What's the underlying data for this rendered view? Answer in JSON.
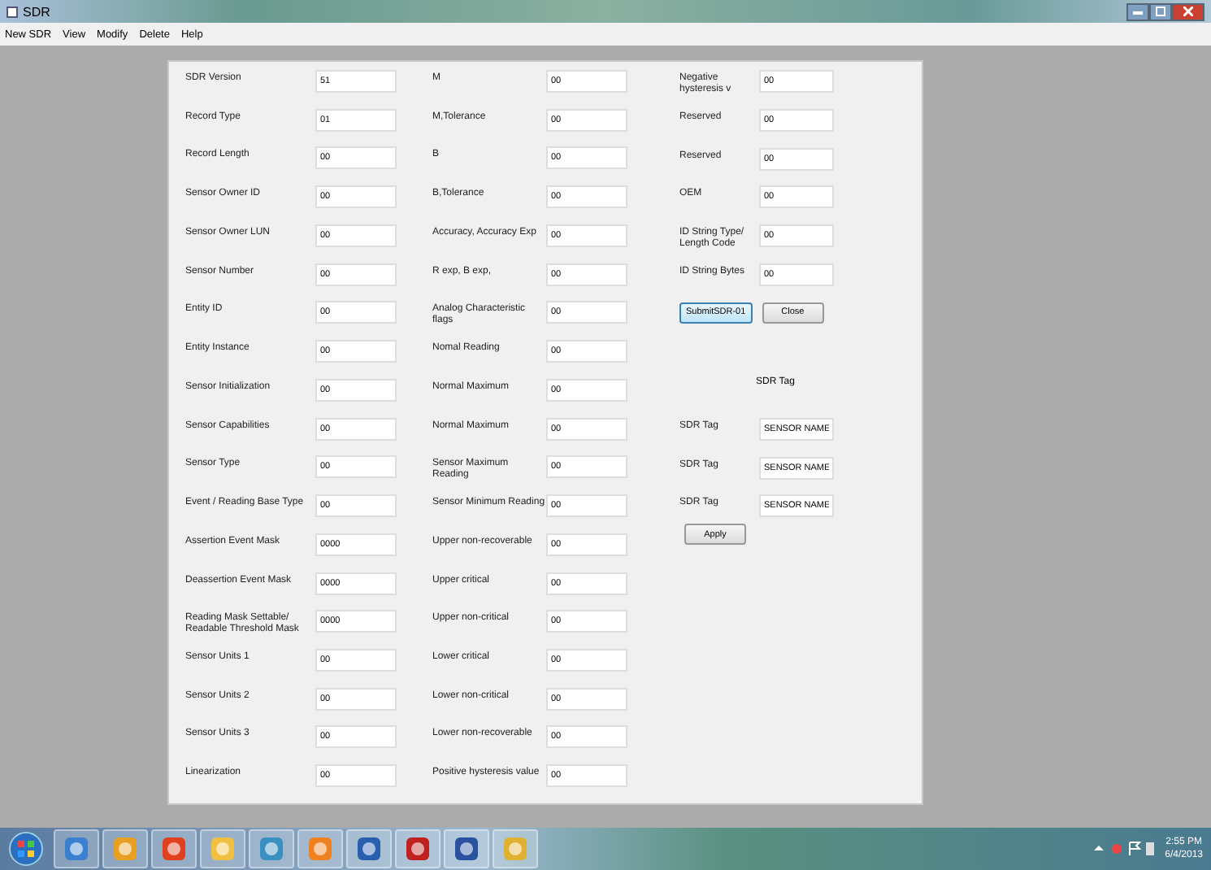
{
  "window": {
    "title": "SDR"
  },
  "menu": [
    "New SDR",
    "View",
    "Modify",
    "Delete",
    "Help"
  ],
  "columns": [
    {
      "fields": [
        {
          "label": "SDR Version",
          "value": "51"
        },
        {
          "label": "Record Type",
          "value": "01"
        },
        {
          "label": "Record Length",
          "value": "00"
        },
        {
          "label": "Sensor Owner ID",
          "value": "00"
        },
        {
          "label": "Sensor Owner LUN",
          "value": "00"
        },
        {
          "label": "Sensor Number",
          "value": "00"
        },
        {
          "label": "Entity ID",
          "value": "00"
        },
        {
          "label": "Entity Instance",
          "value": "00"
        },
        {
          "label": "Sensor Initialization",
          "value": "00"
        },
        {
          "label": "Sensor Capabilities",
          "value": "00"
        },
        {
          "label": "Sensor Type",
          "value": "00"
        },
        {
          "label": "Event / Reading Base Type",
          "value": "00"
        },
        {
          "label": "Assertion Event Mask",
          "value": "0000"
        },
        {
          "label": "Deassertion Event Mask",
          "value": "0000"
        },
        {
          "label": "Reading Mask Settable/ Readable Threshold Mask",
          "value": "0000"
        },
        {
          "label": "Sensor Units 1",
          "value": "00"
        },
        {
          "label": "Sensor Units 2",
          "value": "00"
        },
        {
          "label": "Sensor Units 3",
          "value": "00"
        },
        {
          "label": "Linearization",
          "value": "00"
        }
      ]
    },
    {
      "fields": [
        {
          "label": "M",
          "value": "00"
        },
        {
          "label": "M,Tolerance",
          "value": "00"
        },
        {
          "label": "B",
          "value": "00"
        },
        {
          "label": "B,Tolerance",
          "value": "00"
        },
        {
          "label": "Accuracy, Accuracy Exp",
          "value": "00"
        },
        {
          "label": "R exp, B exp,",
          "value": "00"
        },
        {
          "label": "Analog Characteristic flags",
          "value": "00"
        },
        {
          "label": "Nomal Reading",
          "value": "00"
        },
        {
          "label": "Normal Maximum",
          "value": "00"
        },
        {
          "label": "Normal Maximum",
          "value": "00"
        },
        {
          "label": "Sensor Maximum Reading",
          "value": "00"
        },
        {
          "label": "Sensor Minimum Reading",
          "value": "00"
        },
        {
          "label": "Upper non-recoverable",
          "value": "00"
        },
        {
          "label": "Upper critical",
          "value": "00"
        },
        {
          "label": "Upper non-critical",
          "value": "00"
        },
        {
          "label": "Lower critical",
          "value": "00"
        },
        {
          "label": "Lower non-critical",
          "value": "00"
        },
        {
          "label": "Lower non-recoverable",
          "value": "00"
        },
        {
          "label": "Positive hysteresis value",
          "value": "00"
        }
      ]
    }
  ],
  "right": {
    "fields": [
      {
        "label": "Negative hysteresis v",
        "value": "00"
      },
      {
        "label": "Reserved",
        "value": "00"
      },
      {
        "label": "Reserved",
        "value": "00"
      },
      {
        "label": "OEM",
        "value": "00"
      },
      {
        "label": "ID String Type/ Length Code",
        "value": "00"
      },
      {
        "label": "ID String Bytes",
        "value": "00"
      }
    ],
    "buttons": [
      {
        "label": "SubmitSDR-01",
        "focused": true
      },
      {
        "label": "Close",
        "focused": false
      }
    ],
    "tag_heading": "SDR Tag",
    "tags": [
      {
        "label": "SDR Tag",
        "value": "SENSOR NAME"
      },
      {
        "label": "SDR Tag",
        "value": "SENSOR NAME"
      },
      {
        "label": "SDR Tag",
        "value": "SENSOR NAME"
      }
    ],
    "apply": "Apply"
  },
  "taskbar": {
    "time": "2:55 PM",
    "date": "6/4/2013"
  }
}
